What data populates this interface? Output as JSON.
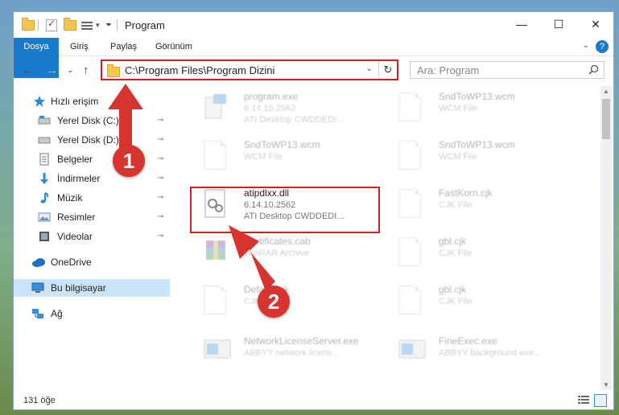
{
  "window": {
    "title": "Program",
    "minimize_glyph": "—",
    "maximize_glyph": "☐",
    "close_glyph": "✕"
  },
  "ribbon": {
    "tabs": [
      "Dosya",
      "Giriş",
      "Paylaş",
      "Görünüm"
    ],
    "help_glyph": "?",
    "collapse_glyph": "⌄"
  },
  "address": {
    "path": "C:\\Program Files\\Program Dizini",
    "dropdown_glyph": "⌄",
    "refresh_glyph": "↻"
  },
  "search": {
    "placeholder": "Ara: Program",
    "icon": "search-icon"
  },
  "nav": {
    "back": "←",
    "forward": "→",
    "recent": "⌄",
    "up": "↑"
  },
  "navpane": {
    "items": [
      {
        "label": "Hızlı erişim",
        "icon": "star-icon",
        "pinned": false
      },
      {
        "label": "Yerel Disk (C:)",
        "icon": "drive-icon",
        "pinned": true
      },
      {
        "label": "Yerel Disk (D:)",
        "icon": "drive-icon",
        "pinned": true
      },
      {
        "label": "Belgeler",
        "icon": "documents-icon",
        "pinned": true
      },
      {
        "label": "İndirmeler",
        "icon": "download-icon",
        "pinned": true
      },
      {
        "label": "Müzik",
        "icon": "music-icon",
        "pinned": true
      },
      {
        "label": "Resimler",
        "icon": "pictures-icon",
        "pinned": true
      },
      {
        "label": "Videolar",
        "icon": "videos-icon",
        "pinned": true
      },
      {
        "label": "OneDrive",
        "icon": "onedrive-icon",
        "pinned": false
      },
      {
        "label": "Bu bilgisayar",
        "icon": "computer-icon",
        "pinned": false
      },
      {
        "label": "Ağ",
        "icon": "network-icon",
        "pinned": false
      }
    ],
    "pin_glyph": "📌"
  },
  "files": [
    {
      "name": "program.exe",
      "line2": "6.14.10.2562",
      "line3": "ATI Desktop CWDDEDI...",
      "icon": "program-icon"
    },
    {
      "name": "SndToWP13.wcm",
      "line2": "WCM File",
      "line3": "",
      "icon": "doc-icon"
    },
    {
      "name": "SndToWP13.wcm",
      "line2": "WCM File",
      "line3": "",
      "icon": "doc-icon"
    },
    {
      "name": "SndToWP13.wcm",
      "line2": "WCM File",
      "line3": "",
      "icon": "doc-icon"
    },
    {
      "name": "atipdlxx.dll",
      "line2": "6.14.10.2562",
      "line3": "ATI Desktop CWDDEDI...",
      "icon": "dll-icon"
    },
    {
      "name": "FastKorn.cjk",
      "line2": "CJK File",
      "line3": "",
      "icon": "doc-icon"
    },
    {
      "name": "Certificates.cab",
      "line2": "WinRAR Archive",
      "line3": "",
      "icon": "winrar-icon"
    },
    {
      "name": "gbl.cjk",
      "line2": "CJK File",
      "line3": "",
      "icon": "doc-icon"
    },
    {
      "name": "Default.cjk",
      "line2": "CJK File",
      "line3": "",
      "icon": "doc-icon"
    },
    {
      "name": "gbl.cjk",
      "line2": "CJK File",
      "line3": "",
      "icon": "doc-icon"
    },
    {
      "name": "NetworkLicenseServer.exe",
      "line2": "ABBYY network licens...",
      "line3": "",
      "icon": "app-icon"
    },
    {
      "name": "FineExec.exe",
      "line2": "ABBYY background exe...",
      "line3": "",
      "icon": "app-icon"
    }
  ],
  "status": {
    "count": "131 öğe"
  },
  "annotations": [
    "1",
    "2"
  ],
  "colors": {
    "accent": "#1979ca",
    "highlight": "#cc2222",
    "badge": "#d7332f",
    "selected": "#cce4f7"
  }
}
